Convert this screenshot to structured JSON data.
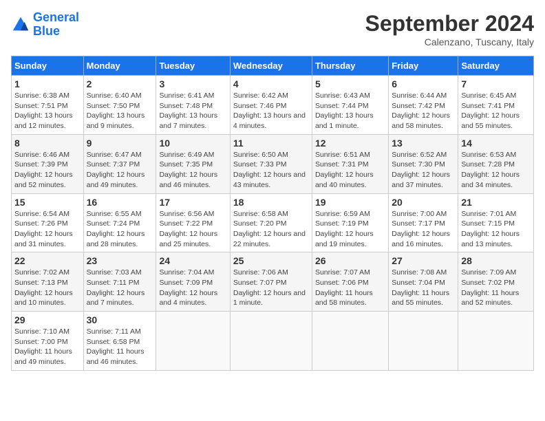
{
  "header": {
    "logo_general": "General",
    "logo_blue": "Blue",
    "month_title": "September 2024",
    "location": "Calenzano, Tuscany, Italy"
  },
  "columns": [
    "Sunday",
    "Monday",
    "Tuesday",
    "Wednesday",
    "Thursday",
    "Friday",
    "Saturday"
  ],
  "weeks": [
    [
      {
        "day": "1",
        "sunrise": "Sunrise: 6:38 AM",
        "sunset": "Sunset: 7:51 PM",
        "daylight": "Daylight: 13 hours and 12 minutes."
      },
      {
        "day": "2",
        "sunrise": "Sunrise: 6:40 AM",
        "sunset": "Sunset: 7:50 PM",
        "daylight": "Daylight: 13 hours and 9 minutes."
      },
      {
        "day": "3",
        "sunrise": "Sunrise: 6:41 AM",
        "sunset": "Sunset: 7:48 PM",
        "daylight": "Daylight: 13 hours and 7 minutes."
      },
      {
        "day": "4",
        "sunrise": "Sunrise: 6:42 AM",
        "sunset": "Sunset: 7:46 PM",
        "daylight": "Daylight: 13 hours and 4 minutes."
      },
      {
        "day": "5",
        "sunrise": "Sunrise: 6:43 AM",
        "sunset": "Sunset: 7:44 PM",
        "daylight": "Daylight: 13 hours and 1 minute."
      },
      {
        "day": "6",
        "sunrise": "Sunrise: 6:44 AM",
        "sunset": "Sunset: 7:42 PM",
        "daylight": "Daylight: 12 hours and 58 minutes."
      },
      {
        "day": "7",
        "sunrise": "Sunrise: 6:45 AM",
        "sunset": "Sunset: 7:41 PM",
        "daylight": "Daylight: 12 hours and 55 minutes."
      }
    ],
    [
      {
        "day": "8",
        "sunrise": "Sunrise: 6:46 AM",
        "sunset": "Sunset: 7:39 PM",
        "daylight": "Daylight: 12 hours and 52 minutes."
      },
      {
        "day": "9",
        "sunrise": "Sunrise: 6:47 AM",
        "sunset": "Sunset: 7:37 PM",
        "daylight": "Daylight: 12 hours and 49 minutes."
      },
      {
        "day": "10",
        "sunrise": "Sunrise: 6:49 AM",
        "sunset": "Sunset: 7:35 PM",
        "daylight": "Daylight: 12 hours and 46 minutes."
      },
      {
        "day": "11",
        "sunrise": "Sunrise: 6:50 AM",
        "sunset": "Sunset: 7:33 PM",
        "daylight": "Daylight: 12 hours and 43 minutes."
      },
      {
        "day": "12",
        "sunrise": "Sunrise: 6:51 AM",
        "sunset": "Sunset: 7:31 PM",
        "daylight": "Daylight: 12 hours and 40 minutes."
      },
      {
        "day": "13",
        "sunrise": "Sunrise: 6:52 AM",
        "sunset": "Sunset: 7:30 PM",
        "daylight": "Daylight: 12 hours and 37 minutes."
      },
      {
        "day": "14",
        "sunrise": "Sunrise: 6:53 AM",
        "sunset": "Sunset: 7:28 PM",
        "daylight": "Daylight: 12 hours and 34 minutes."
      }
    ],
    [
      {
        "day": "15",
        "sunrise": "Sunrise: 6:54 AM",
        "sunset": "Sunset: 7:26 PM",
        "daylight": "Daylight: 12 hours and 31 minutes."
      },
      {
        "day": "16",
        "sunrise": "Sunrise: 6:55 AM",
        "sunset": "Sunset: 7:24 PM",
        "daylight": "Daylight: 12 hours and 28 minutes."
      },
      {
        "day": "17",
        "sunrise": "Sunrise: 6:56 AM",
        "sunset": "Sunset: 7:22 PM",
        "daylight": "Daylight: 12 hours and 25 minutes."
      },
      {
        "day": "18",
        "sunrise": "Sunrise: 6:58 AM",
        "sunset": "Sunset: 7:20 PM",
        "daylight": "Daylight: 12 hours and 22 minutes."
      },
      {
        "day": "19",
        "sunrise": "Sunrise: 6:59 AM",
        "sunset": "Sunset: 7:19 PM",
        "daylight": "Daylight: 12 hours and 19 minutes."
      },
      {
        "day": "20",
        "sunrise": "Sunrise: 7:00 AM",
        "sunset": "Sunset: 7:17 PM",
        "daylight": "Daylight: 12 hours and 16 minutes."
      },
      {
        "day": "21",
        "sunrise": "Sunrise: 7:01 AM",
        "sunset": "Sunset: 7:15 PM",
        "daylight": "Daylight: 12 hours and 13 minutes."
      }
    ],
    [
      {
        "day": "22",
        "sunrise": "Sunrise: 7:02 AM",
        "sunset": "Sunset: 7:13 PM",
        "daylight": "Daylight: 12 hours and 10 minutes."
      },
      {
        "day": "23",
        "sunrise": "Sunrise: 7:03 AM",
        "sunset": "Sunset: 7:11 PM",
        "daylight": "Daylight: 12 hours and 7 minutes."
      },
      {
        "day": "24",
        "sunrise": "Sunrise: 7:04 AM",
        "sunset": "Sunset: 7:09 PM",
        "daylight": "Daylight: 12 hours and 4 minutes."
      },
      {
        "day": "25",
        "sunrise": "Sunrise: 7:06 AM",
        "sunset": "Sunset: 7:07 PM",
        "daylight": "Daylight: 12 hours and 1 minute."
      },
      {
        "day": "26",
        "sunrise": "Sunrise: 7:07 AM",
        "sunset": "Sunset: 7:06 PM",
        "daylight": "Daylight: 11 hours and 58 minutes."
      },
      {
        "day": "27",
        "sunrise": "Sunrise: 7:08 AM",
        "sunset": "Sunset: 7:04 PM",
        "daylight": "Daylight: 11 hours and 55 minutes."
      },
      {
        "day": "28",
        "sunrise": "Sunrise: 7:09 AM",
        "sunset": "Sunset: 7:02 PM",
        "daylight": "Daylight: 11 hours and 52 minutes."
      }
    ],
    [
      {
        "day": "29",
        "sunrise": "Sunrise: 7:10 AM",
        "sunset": "Sunset: 7:00 PM",
        "daylight": "Daylight: 11 hours and 49 minutes."
      },
      {
        "day": "30",
        "sunrise": "Sunrise: 7:11 AM",
        "sunset": "Sunset: 6:58 PM",
        "daylight": "Daylight: 11 hours and 46 minutes."
      },
      null,
      null,
      null,
      null,
      null
    ]
  ]
}
